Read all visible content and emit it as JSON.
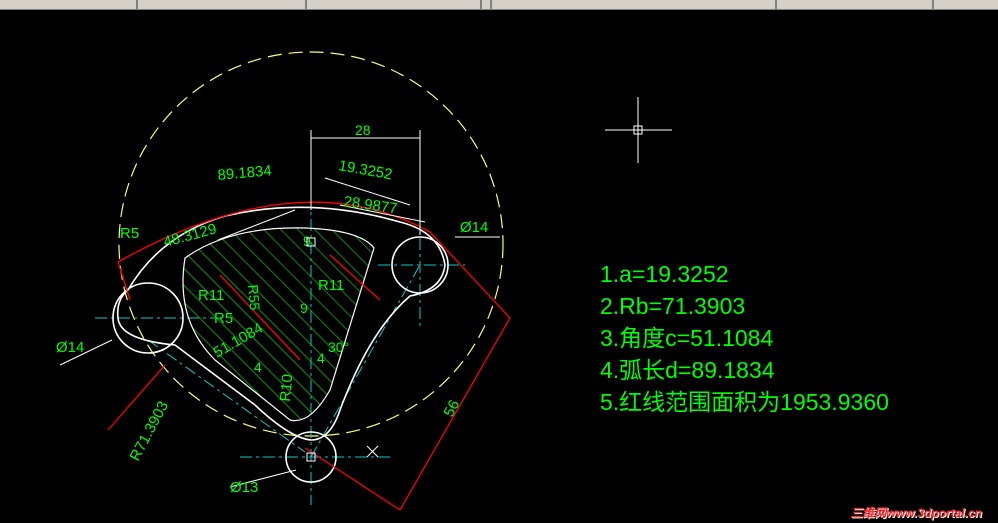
{
  "colors": {
    "background": "#000000",
    "geometry": "#ffffff",
    "dimensions": "#00ff00",
    "boundary": "#ff0000",
    "centerlines": "#00cccc",
    "construction": "#ffff66",
    "crosshair": "#ffffff"
  },
  "dimensions": {
    "width_28": "28",
    "a": "19.3252",
    "chord": "28.9877",
    "arc": "89.1834",
    "r5_top": "R5",
    "dist_48": "48.3129",
    "dia14_right": "Ø14",
    "dia14_left": "Ø14",
    "dia13": "Ø13",
    "r11_left": "R11",
    "r11_right": "R11",
    "r55": "R55",
    "r5_inner": "R5",
    "angle": "51.1084",
    "nine_top": "9",
    "nine_mid": "9",
    "four_left": "4",
    "four_right": "4",
    "deg30": "30°",
    "r10": "R10",
    "rb": "R71.3903",
    "dist56": "56"
  },
  "results": [
    "1.a=19.3252",
    "2.Rb=71.3903",
    "3.角度c=51.1084",
    "4.弧长d=89.1834",
    "5.红线范围面积为1953.9360"
  ],
  "watermark": "三维网www.3dportal.cn",
  "icons": [
    "crosshair-cursor-icon",
    "center-mark-icon",
    "x-mark-icon"
  ]
}
